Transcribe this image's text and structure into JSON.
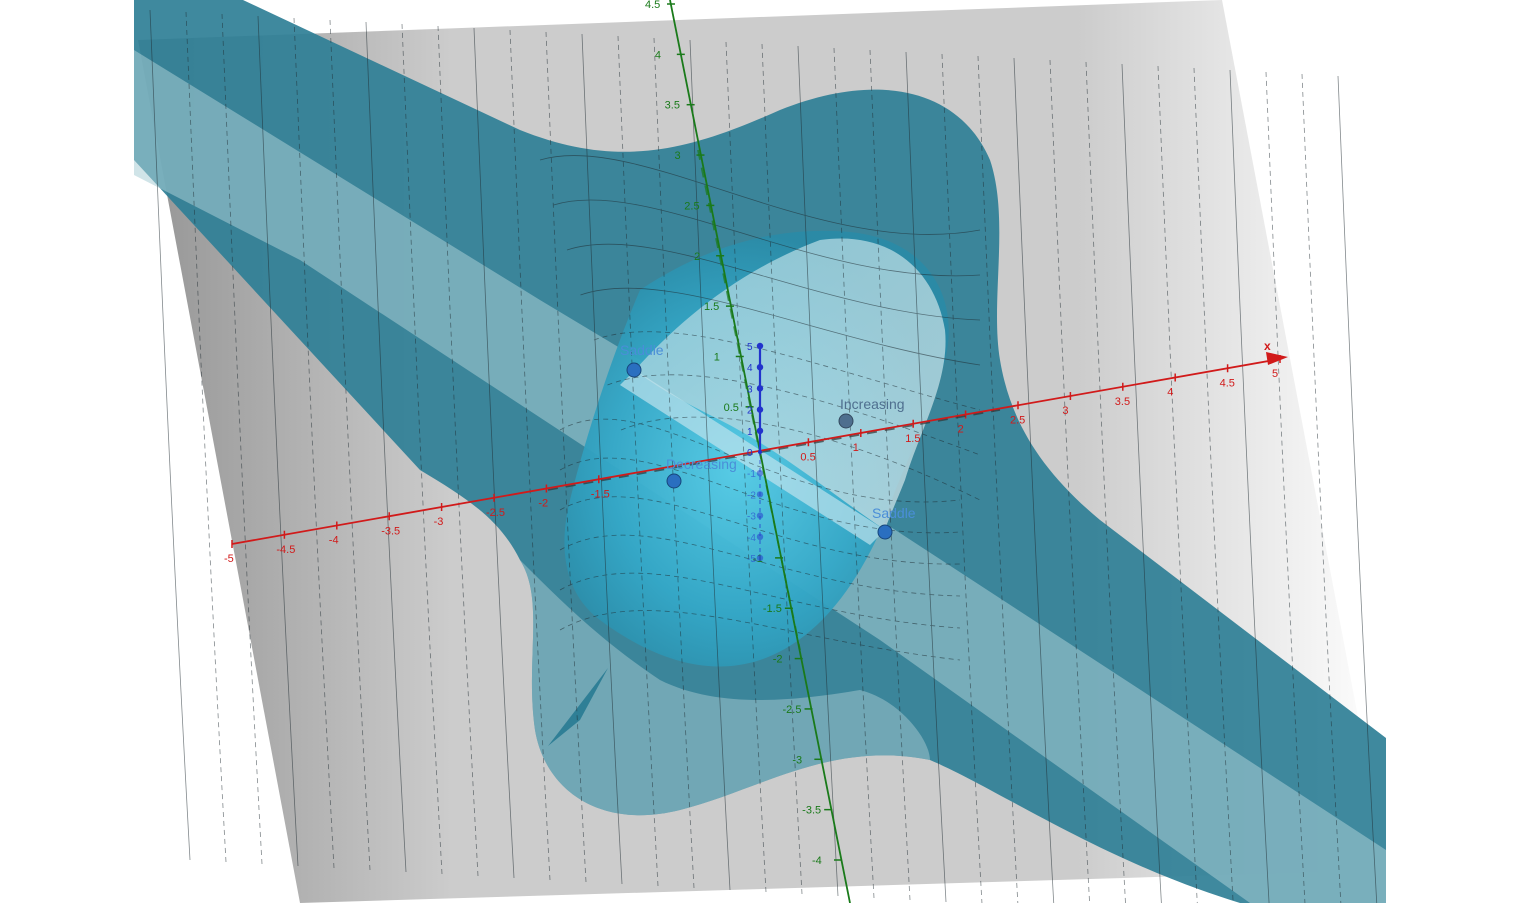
{
  "colors": {
    "surface_dark": "#2f7f96",
    "surface_light": "#3fb6d6",
    "plane_grey": "#c7c7c7",
    "x_axis": "#d11a1a",
    "y_axis": "#1a7a1a",
    "z_axis": "#2233cc",
    "point": "#2a6fc0",
    "label": "#4a8ed8"
  },
  "axes": {
    "x_name": "x",
    "x_ticks": [
      "-5",
      "-4.5",
      "-4",
      "-3.5",
      "-3",
      "-2.5",
      "-2",
      "-1.5",
      "0.5",
      "1",
      "1.5",
      "2",
      "2.5",
      "3",
      "3.5",
      "4",
      "4.5",
      "5"
    ],
    "y_ticks": [
      "4.5",
      "4",
      "3.5",
      "3",
      "2.5",
      "2",
      "1.5",
      "1",
      "0.5",
      "-1",
      "-1.5",
      "-2",
      "-2.5",
      "-3",
      "-3.5",
      "-4"
    ],
    "z_ticks": [
      "5",
      "4",
      "3",
      "2",
      "1",
      "0",
      "-1",
      "-2",
      "-3",
      "-4",
      "-5"
    ]
  },
  "points": {
    "saddle_1": "Saddle",
    "saddle_2": "Saddle",
    "increasing": "Increasing",
    "decreasing": "Decreasing"
  },
  "icons": {
    "point_marker": "filled-circle",
    "axis_arrow": "arrowhead"
  }
}
